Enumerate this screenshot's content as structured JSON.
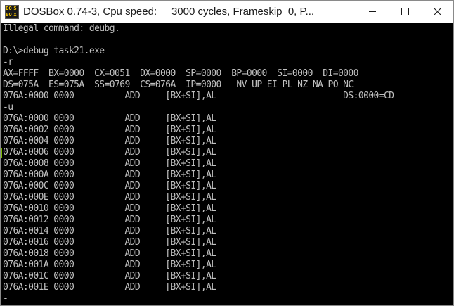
{
  "window": {
    "title": "DOSBox 0.74-3, Cpu speed:     3000 cycles, Frameskip  0, P...",
    "icon": "dosbox-icon",
    "icon_text": [
      "DO",
      "S",
      "BO",
      "X"
    ]
  },
  "console": {
    "lines": [
      "Illegal command: deubg.",
      "",
      "D:\\>debug task21.exe",
      "-r",
      "AX=FFFF  BX=0000  CX=0051  DX=0000  SP=0000  BP=0000  SI=0000  DI=0000",
      "DS=075A  ES=075A  SS=0769  CS=076A  IP=0000   NV UP EI PL NZ NA PO NC",
      "076A:0000 0000          ADD     [BX+SI],AL                         DS:0000=CD",
      "-u",
      "076A:0000 0000          ADD     [BX+SI],AL",
      "076A:0002 0000          ADD     [BX+SI],AL",
      "076A:0004 0000          ADD     [BX+SI],AL",
      "076A:0006 0000          ADD     [BX+SI],AL",
      "076A:0008 0000          ADD     [BX+SI],AL",
      "076A:000A 0000          ADD     [BX+SI],AL",
      "076A:000C 0000          ADD     [BX+SI],AL",
      "076A:000E 0000          ADD     [BX+SI],AL",
      "076A:0010 0000          ADD     [BX+SI],AL",
      "076A:0012 0000          ADD     [BX+SI],AL",
      "076A:0014 0000          ADD     [BX+SI],AL",
      "076A:0016 0000          ADD     [BX+SI],AL",
      "076A:0018 0000          ADD     [BX+SI],AL",
      "076A:001A 0000          ADD     [BX+SI],AL",
      "076A:001C 0000          ADD     [BX+SI],AL",
      "076A:001E 0000          ADD     [BX+SI],AL",
      "-"
    ]
  },
  "colors": {
    "console_bg": "#000000",
    "console_text": "#c0c0c0",
    "titlebar_bg": "#ffffff"
  }
}
